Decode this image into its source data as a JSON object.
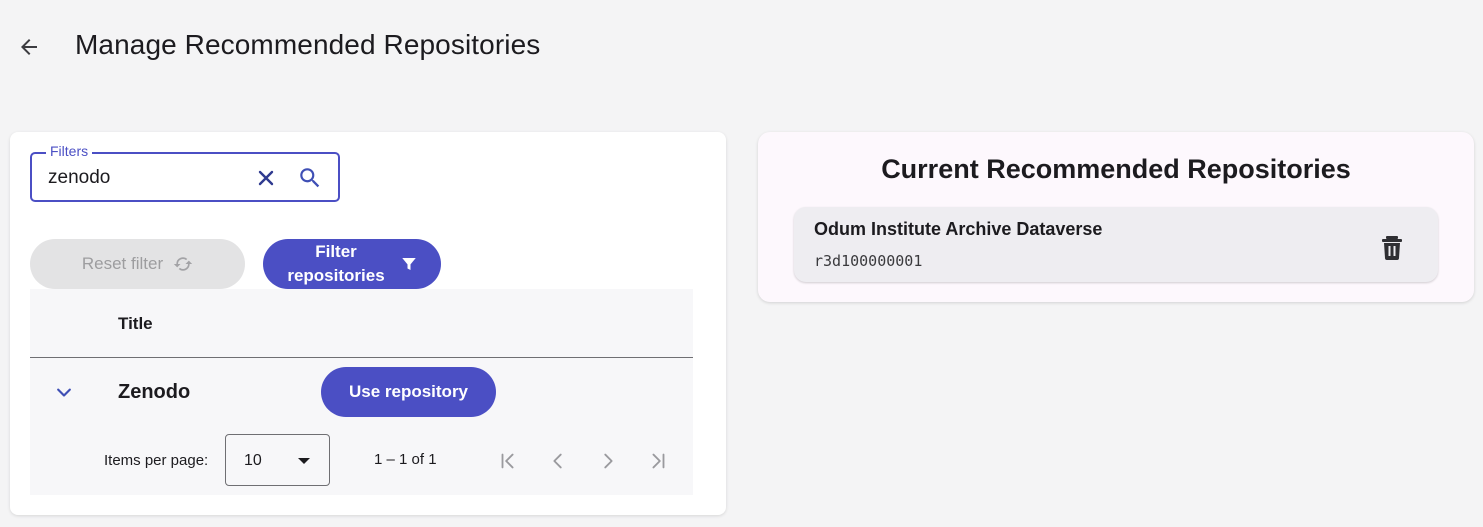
{
  "header": {
    "title": "Manage Recommended Repositories",
    "back_icon": "arrow-back-icon"
  },
  "filters": {
    "label": "Filters",
    "value": "zenodo",
    "clear_icon": "close-icon",
    "search_icon": "search-icon"
  },
  "actions": {
    "reset_label": "Reset filter",
    "reset_icon": "refresh-icon",
    "filter_label": "Filter repositories",
    "filter_icon": "funnel-icon"
  },
  "table": {
    "columns": [
      "Title"
    ],
    "rows": [
      {
        "title": "Zenodo",
        "action_label": "Use repository"
      }
    ]
  },
  "paginator": {
    "items_per_page_label": "Items per page:",
    "items_per_page_value": "10",
    "range": "1 – 1 of 1"
  },
  "current": {
    "title": "Current Recommended Repositories",
    "items": [
      {
        "name": "Odum Institute Archive Dataverse",
        "id": "r3d100000001"
      }
    ]
  },
  "colors": {
    "primary": "#4b4fc4",
    "background": "#f4f4f5",
    "disabled_button": "#e3e3e4"
  }
}
